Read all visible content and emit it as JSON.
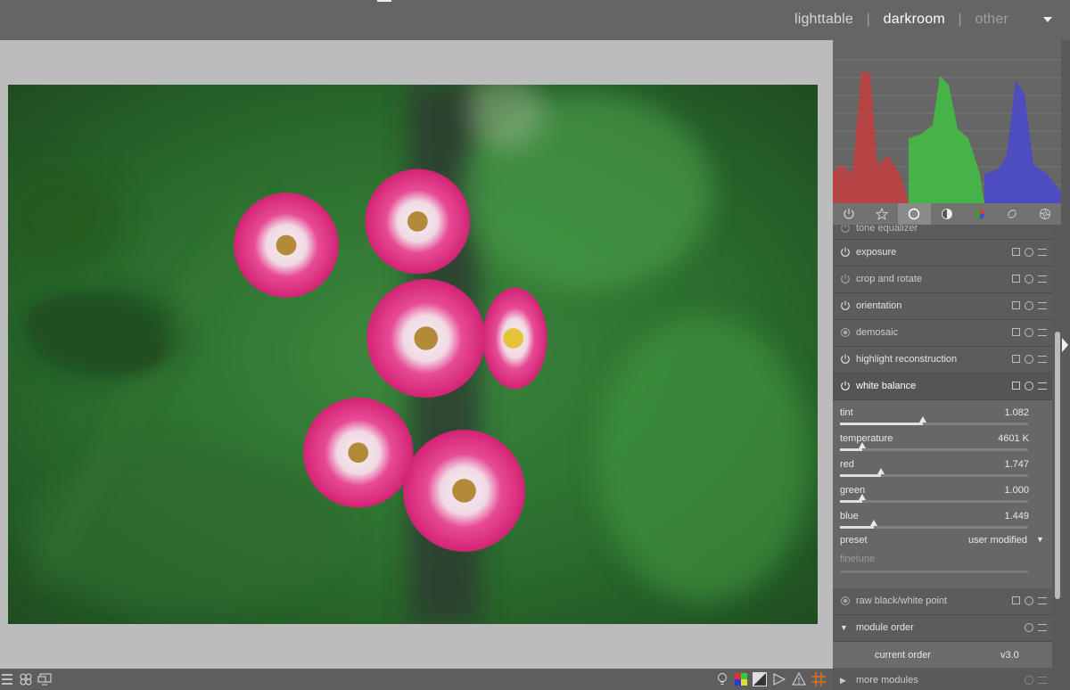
{
  "header": {
    "views": [
      {
        "label": "lighttable",
        "state": "normal"
      },
      {
        "label": "darkroom",
        "state": "active"
      },
      {
        "label": "other",
        "state": "dim"
      }
    ],
    "separator": "|"
  },
  "histogram": {
    "colors": {
      "red": "#d33a3a",
      "green": "#3ecc3e",
      "blue": "#4545dd"
    }
  },
  "module_groups": [
    "power-icon",
    "star-icon",
    "circle-icon",
    "half-circle-icon",
    "color-wheel-icon",
    "rotate-icon",
    "aperture-icon"
  ],
  "modules": {
    "tone_equalizer": "tone equalizer",
    "exposure": "exposure",
    "crop": "crop and rotate",
    "orientation": "orientation",
    "demosaic": "demosaic",
    "highlight": "highlight reconstruction",
    "white_balance": "white balance",
    "raw_bw": "raw black/white point",
    "module_order": "module order",
    "current_order_label": "current order",
    "current_order_value": "v3.0",
    "more_modules": "more modules"
  },
  "white_balance": {
    "sliders": [
      {
        "name": "tint",
        "value": "1.082",
        "level": 0.44
      },
      {
        "name": "temperature",
        "value": "4601 K",
        "level": 0.12
      },
      {
        "name": "red",
        "value": "1.747",
        "level": 0.22
      },
      {
        "name": "green",
        "value": "1.000",
        "level": 0.12
      },
      {
        "name": "blue",
        "value": "1.449",
        "level": 0.18
      }
    ],
    "preset_label": "preset",
    "preset_value": "user modified",
    "finetune_label": "finetune"
  }
}
